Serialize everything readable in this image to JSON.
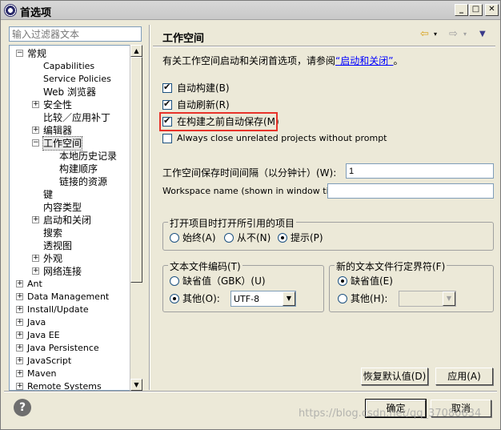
{
  "window": {
    "title": "首选项"
  },
  "filter": {
    "placeholder": "输入过滤器文本"
  },
  "tree": {
    "items": [
      {
        "label": "常规",
        "expanded": true
      },
      {
        "label": "Capabilities"
      },
      {
        "label": "Service Policies"
      },
      {
        "label": "Web 浏览器"
      },
      {
        "label": "安全性"
      },
      {
        "label": "比较／应用补丁"
      },
      {
        "label": "编辑器"
      },
      {
        "label": "工作空间",
        "selected": true
      },
      {
        "label": "本地历史记录"
      },
      {
        "label": "构建顺序"
      },
      {
        "label": "链接的资源"
      },
      {
        "label": "键"
      },
      {
        "label": "内容类型"
      },
      {
        "label": "启动和关闭"
      },
      {
        "label": "搜索"
      },
      {
        "label": "透视图"
      },
      {
        "label": "外观"
      },
      {
        "label": "网络连接"
      },
      {
        "label": "Ant"
      },
      {
        "label": "Data Management"
      },
      {
        "label": "Install/Update"
      },
      {
        "label": "Java"
      },
      {
        "label": "Java EE"
      },
      {
        "label": "Java Persistence"
      },
      {
        "label": "JavaScript"
      },
      {
        "label": "Maven"
      },
      {
        "label": "Remote Systems"
      }
    ]
  },
  "page": {
    "title": "工作空间",
    "desc_prefix": "有关工作空间启动和关闭首选项，请参阅",
    "desc_link": "“启动和关闭”",
    "desc_suffix": "。",
    "checkboxes": [
      {
        "label": "自动构建(B)",
        "checked": true
      },
      {
        "label": "自动刷新(R)",
        "checked": true
      },
      {
        "label": "在构建之前自动保存(M)",
        "checked": true
      },
      {
        "label": "Always close unrelated projects without prompt",
        "checked": false
      }
    ],
    "save_interval_label": "工作空间保存时间间隔（以分钟计）(W):",
    "save_interval_value": "1",
    "workspace_name_label": "Workspace name (shown in window title):",
    "workspace_name_value": "",
    "open_ref_group": {
      "legend": "打开项目时打开所引用的项目",
      "options": [
        "始终(A)",
        "从不(N)",
        "提示(P)"
      ],
      "selected": "提示(P)"
    },
    "encoding_group": {
      "legend": "文本文件编码(T)",
      "default_label": "缺省值（GBK）(U)",
      "other_label": "其他(O):",
      "other_value": "UTF-8",
      "selected": "其他(O):"
    },
    "delimiter_group": {
      "legend": "新的文本文件行定界符(F)",
      "default_label": "缺省值(E)",
      "other_label": "其他(H):",
      "other_value": "",
      "selected": "缺省值(E)"
    },
    "restore_defaults": "恢复默认值(D)",
    "apply": "应用(A)"
  },
  "footer": {
    "ok": "确定",
    "cancel": "取消",
    "watermark": "https://blog.csdn.net/qq_37080634"
  },
  "colors": {
    "highlight_box": "#e8332a",
    "check": "#21a121",
    "link": "#0000ff"
  },
  "icons": [
    "app-icon",
    "back-icon",
    "forward-icon",
    "menu-icon",
    "help-icon"
  ]
}
